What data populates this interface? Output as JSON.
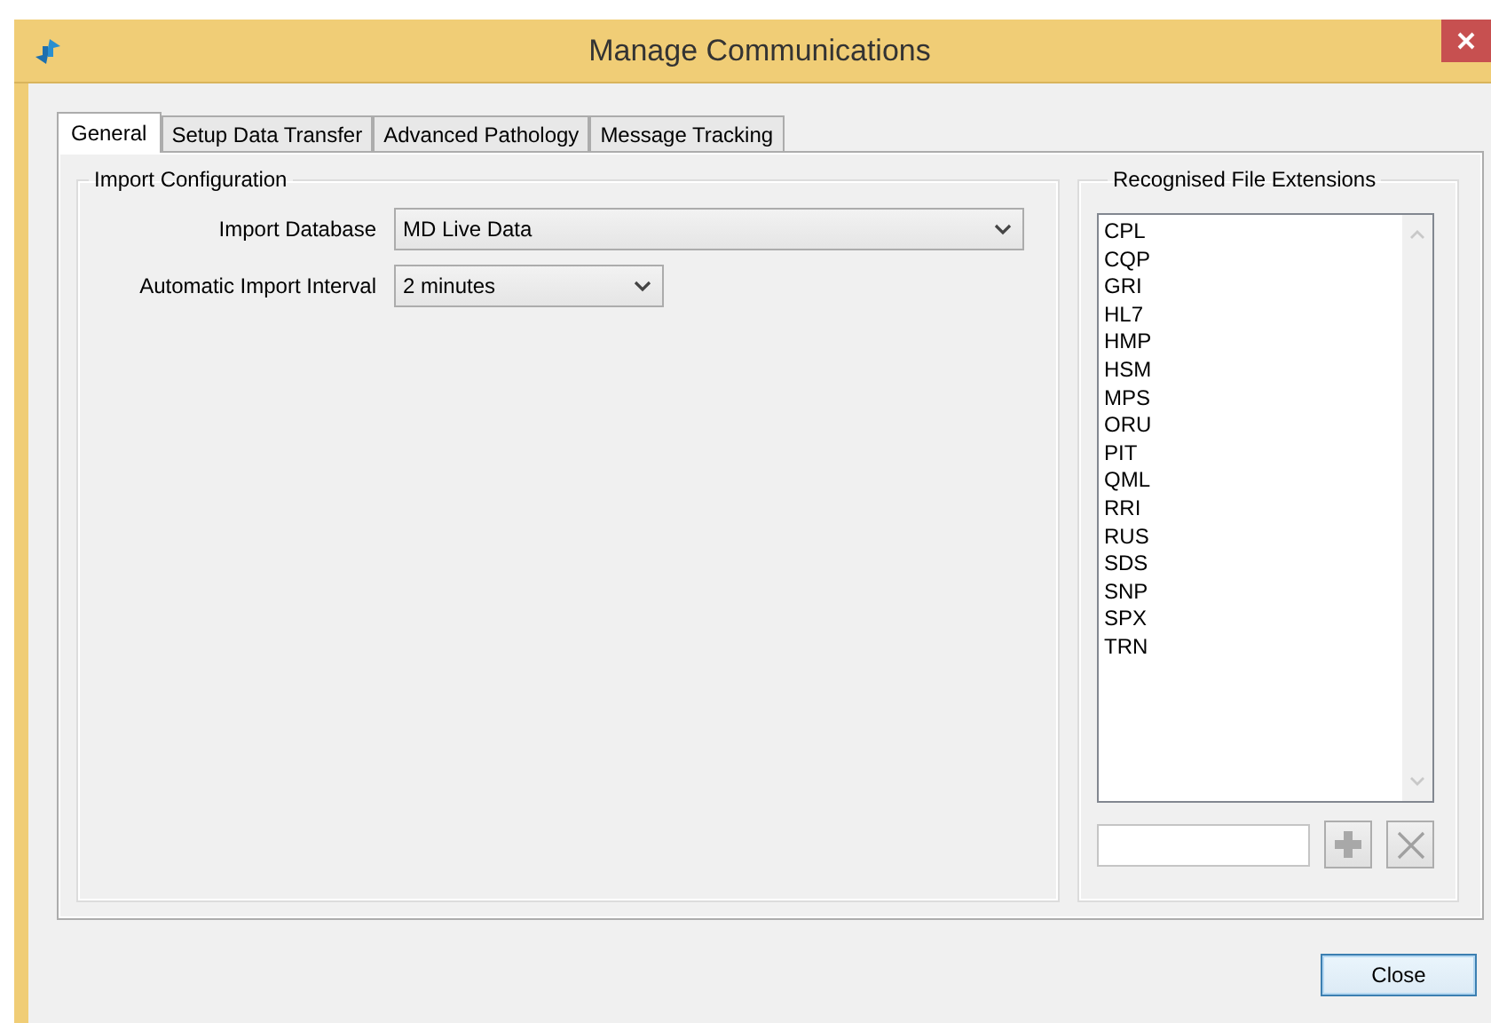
{
  "window": {
    "title": "Manage Communications"
  },
  "tabs": [
    {
      "label": "General",
      "selected": true
    },
    {
      "label": "Setup Data Transfer",
      "selected": false
    },
    {
      "label": "Advanced Pathology",
      "selected": false
    },
    {
      "label": "Message Tracking",
      "selected": false
    }
  ],
  "import_configuration": {
    "title": "Import Configuration",
    "fields": [
      {
        "label": "Import Database",
        "value": "MD Live Data",
        "kind": "wide"
      },
      {
        "label": "Automatic Import Interval",
        "value": "2 minutes",
        "kind": "narrow"
      }
    ]
  },
  "recognised_file_extensions": {
    "title": "Recognised File Extensions",
    "items": [
      "CPL",
      "CQP",
      "GRI",
      "HL7",
      "HMP",
      "HSM",
      "MPS",
      "ORU",
      "PIT",
      "QML",
      "RRI",
      "RUS",
      "SDS",
      "SNP",
      "SPX",
      "TRN"
    ]
  },
  "buttons": [
    {
      "label": "Close"
    }
  ]
}
